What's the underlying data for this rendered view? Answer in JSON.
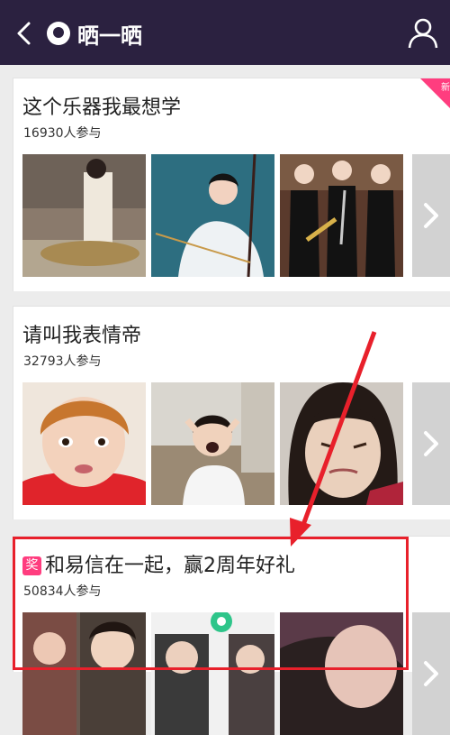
{
  "header": {
    "title": "晒一晒"
  },
  "cards": [
    {
      "title": "这个乐器我最想学",
      "participants": "16930人参与",
      "badge": "新"
    },
    {
      "title": "请叫我表情帝",
      "participants": "32793人参与"
    },
    {
      "title": "和易信在一起，赢2周年好礼",
      "participants": "50834人参与",
      "award": "奖"
    }
  ],
  "colors": {
    "header_bg": "#2b2140",
    "accent_pink": "#ff3d7f",
    "annotation_red": "#e8202b"
  }
}
